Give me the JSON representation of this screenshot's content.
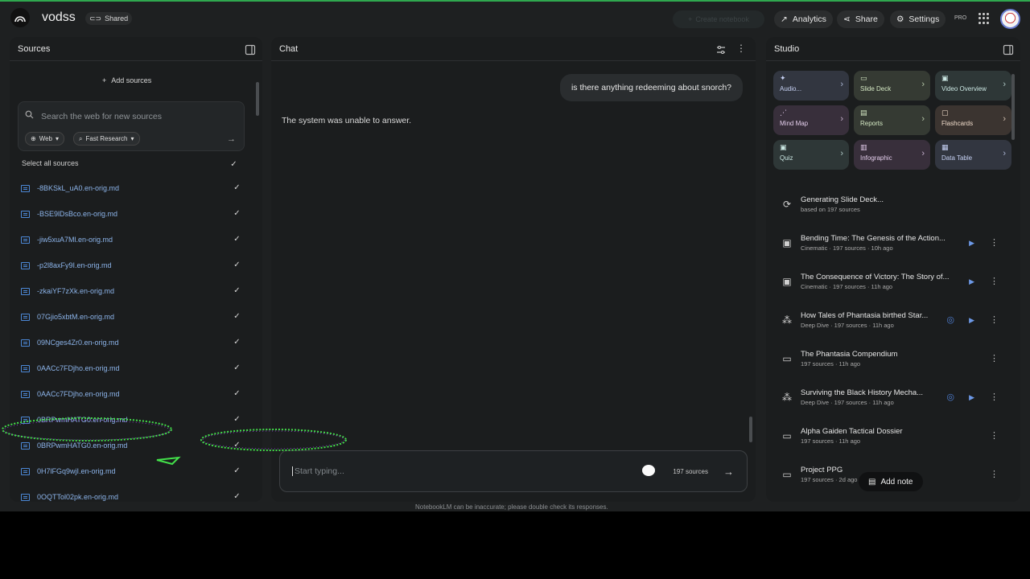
{
  "app": {
    "title": "vodss",
    "shared_label": "Shared"
  },
  "topbar": {
    "ghost_label": "Create notebook",
    "analytics": "Analytics",
    "share": "Share",
    "settings": "Settings",
    "pro": "PRO"
  },
  "sources": {
    "header": "Sources",
    "add_sources": "Add sources",
    "search_placeholder": "Search the web for new sources",
    "chip_web": "Web",
    "chip_research": "Fast Research",
    "select_all": "Select all sources",
    "items": [
      {
        "name": "-8BKSkL_uA0.en-orig.md"
      },
      {
        "name": "-BSE9lDsBco.en-orig.md"
      },
      {
        "name": "-jiw5xuA7Ml.en-orig.md"
      },
      {
        "name": "-p2l8axFy9I.en-orig.md"
      },
      {
        "name": "-zkaiYF7zXk.en-orig.md"
      },
      {
        "name": "07Gjio5xbtM.en-orig.md"
      },
      {
        "name": "09NCges4Zr0.en-orig.md"
      },
      {
        "name": "0AACc7FDjho.en-orig.md"
      },
      {
        "name": "0AACc7FDjho.en-orig.md"
      },
      {
        "name": "0BRPwmHATG0.en-orig.md"
      },
      {
        "name": "0BRPwmHATG0.en-orig.md"
      },
      {
        "name": "0H7lFGq9wjI.en-orig.md"
      },
      {
        "name": "0OQTTol02pk.en-orig.md"
      }
    ]
  },
  "chat": {
    "header": "Chat",
    "user_message": "is there anything redeeming about snorch?",
    "response": "The system was unable to answer.",
    "input_placeholder": "Start typing...",
    "source_count": "197 sources",
    "disclaimer": "NotebookLM can be inaccurate; please double check its responses."
  },
  "studio": {
    "header": "Studio",
    "tiles": [
      {
        "label": "Audio...",
        "icon": "audio-icon",
        "tone": "blue"
      },
      {
        "label": "Slide Deck",
        "icon": "slides-icon",
        "tone": "green"
      },
      {
        "label": "Video Overview",
        "icon": "video-icon",
        "tone": "teal"
      },
      {
        "label": "Mind Map",
        "icon": "mindmap-icon",
        "tone": "purple"
      },
      {
        "label": "Reports",
        "icon": "reports-icon",
        "tone": "green"
      },
      {
        "label": "Flashcards",
        "icon": "flashcards-icon",
        "tone": "orange"
      },
      {
        "label": "Quiz",
        "icon": "quiz-icon",
        "tone": "teal"
      },
      {
        "label": "Infographic",
        "icon": "infographic-icon",
        "tone": "purple"
      },
      {
        "label": "Data Table",
        "icon": "table-icon",
        "tone": "blue"
      }
    ],
    "notes": [
      {
        "title": "Generating Slide Deck...",
        "sub": "based on 197 sources",
        "icon": "sync-icon"
      },
      {
        "title": "Bending Time: The Genesis of the Action...",
        "sub": "Cinematic · 197 sources · 10h ago",
        "icon": "video-icon"
      },
      {
        "title": "The Consequence of Victory: The Story of...",
        "sub": "Cinematic · 197 sources · 11h ago",
        "icon": "video-icon"
      },
      {
        "title": "How Tales of Phantasia birthed Star...",
        "sub": "Deep Dive · 197 sources · 11h ago",
        "icon": "audio-icon"
      },
      {
        "title": "The Phantasia Compendium",
        "sub": "197 sources · 11h ago",
        "icon": "report-icon"
      },
      {
        "title": "Surviving the Black History Mecha...",
        "sub": "Deep Dive · 197 sources · 11h ago",
        "icon": "audio-icon"
      },
      {
        "title": "Alpha Gaiden Tactical Dossier",
        "sub": "197 sources · 11h ago",
        "icon": "report-icon"
      },
      {
        "title": "Project PPG",
        "sub": "197 sources · 2d ago",
        "icon": "report-icon"
      }
    ],
    "add_note": "Add note"
  },
  "colors": {
    "accent_blue": "#8cb4ea",
    "top_border": "#2fa84f",
    "panel": "#1b1d1e"
  }
}
